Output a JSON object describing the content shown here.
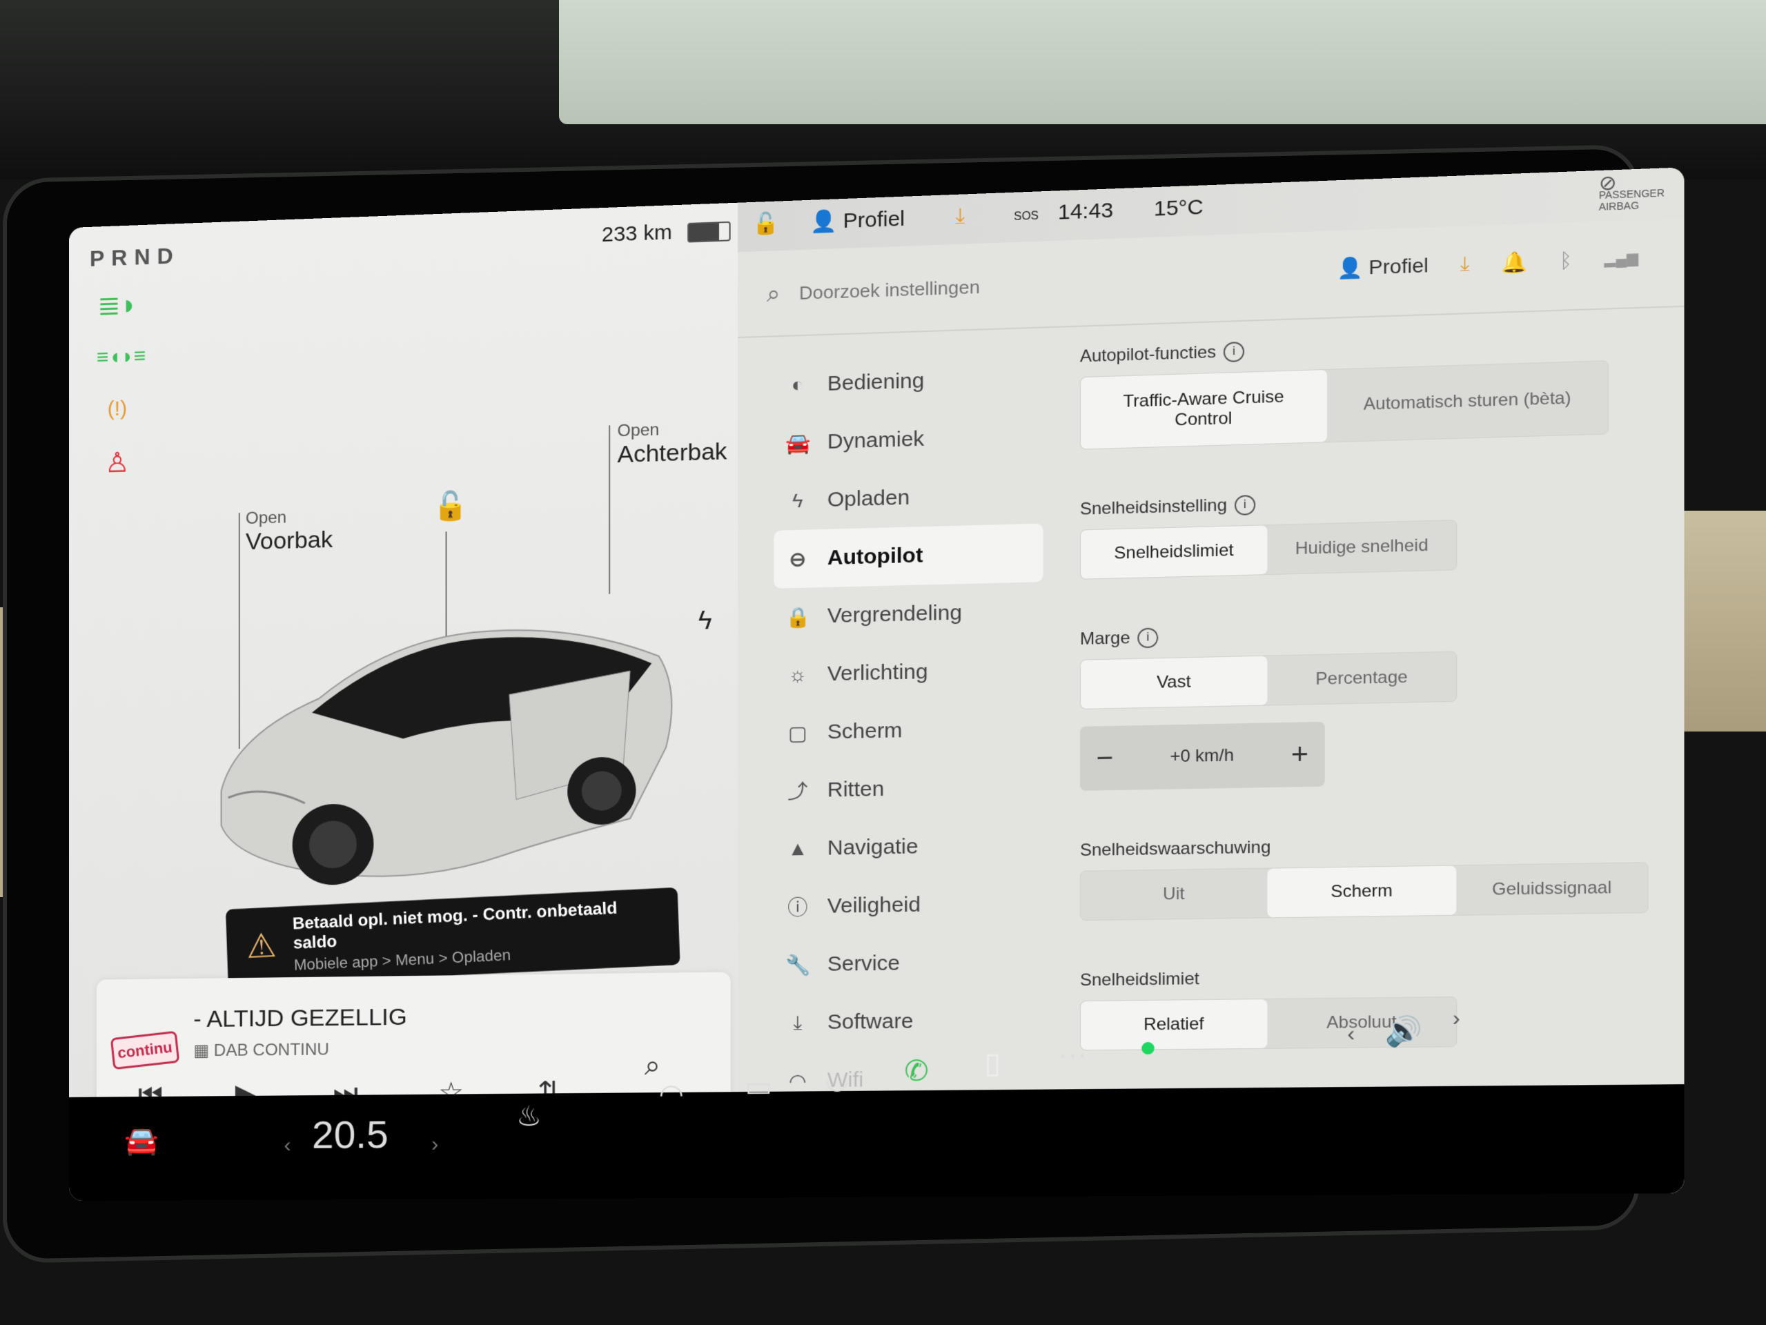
{
  "left_panel": {
    "gear": "PRND",
    "range": "233 km",
    "battery_level": 0.75,
    "telltales": [
      {
        "name": "high-beam-icon",
        "glyph": "≣D",
        "color": "#3fbf5a"
      },
      {
        "name": "parking-lights-icon",
        "glyph": "≡DC≡",
        "color": "#3fbf5a"
      },
      {
        "name": "tire-pressure-icon",
        "glyph": "(!)",
        "color": "#e39a32"
      },
      {
        "name": "seatbelt-icon",
        "glyph": "✗",
        "color": "#e0333b"
      }
    ],
    "frunk": {
      "action": "Open",
      "label": "Voorbak"
    },
    "trunk": {
      "action": "Open",
      "label": "Achterbak"
    },
    "alert": {
      "title": "Betaald opl. niet mog. - Contr. onbetaald saldo",
      "subtitle": "Mobiele app > Menu > Opladen"
    },
    "media": {
      "station_logo": "continu",
      "title": "- ALTIJD GEZELLIG",
      "source": "DAB CONTINU",
      "page_indicator": "• • •"
    }
  },
  "status_bar": {
    "profile": "Profiel",
    "time": "14:43",
    "temperature": "15°C",
    "sos": "SOS",
    "airbag_line1": "PASSENGER",
    "airbag_line2": "AIRBAG"
  },
  "settings": {
    "search_placeholder": "Doorzoek instellingen",
    "profile": "Profiel",
    "nav": [
      {
        "label": "Bediening",
        "icon": "toggle-icon",
        "glyph": "◐"
      },
      {
        "label": "Dynamiek",
        "icon": "car-icon",
        "glyph": "🚘"
      },
      {
        "label": "Opladen",
        "icon": "bolt-icon",
        "glyph": "ϟ"
      },
      {
        "label": "Autopilot",
        "icon": "steering-wheel-icon",
        "glyph": "⊖",
        "active": true
      },
      {
        "label": "Vergrendeling",
        "icon": "lock-icon",
        "glyph": "🔒"
      },
      {
        "label": "Verlichting",
        "icon": "light-icon",
        "glyph": "☼"
      },
      {
        "label": "Scherm",
        "icon": "display-icon",
        "glyph": "▢"
      },
      {
        "label": "Ritten",
        "icon": "trips-icon",
        "glyph": "⤴"
      },
      {
        "label": "Navigatie",
        "icon": "navigation-icon",
        "glyph": "▲"
      },
      {
        "label": "Veiligheid",
        "icon": "safety-icon",
        "glyph": "ⓘ"
      },
      {
        "label": "Service",
        "icon": "wrench-icon",
        "glyph": "🔧"
      },
      {
        "label": "Software",
        "icon": "download-icon",
        "glyph": "⤓"
      },
      {
        "label": "Wifi",
        "icon": "wifi-icon",
        "glyph": "◠"
      }
    ],
    "autopilot_features": {
      "label": "Autopilot-functies",
      "options": [
        "Traffic-Aware Cruise Control",
        "Automatisch sturen (bèta)"
      ],
      "selected": 0
    },
    "speed_setting": {
      "label": "Snelheidsinstelling",
      "options": [
        "Snelheidslimiet",
        "Huidige snelheid"
      ],
      "selected": 0
    },
    "margin": {
      "label": "Marge",
      "options": [
        "Vast",
        "Percentage"
      ],
      "selected": 0,
      "value": "+0 km/h",
      "minus": "−",
      "plus": "+"
    },
    "speed_warning": {
      "label": "Snelheidswaarschuwing",
      "options": [
        "Uit",
        "Scherm",
        "Geluidssignaal"
      ],
      "selected": 1
    },
    "speed_limit": {
      "label": "Snelheidslimiet",
      "options": [
        "Relatief",
        "Absoluut"
      ],
      "selected": 0
    }
  },
  "bottom_bar": {
    "temperature": "20.5",
    "prev": "‹",
    "next": "›"
  },
  "colors": {
    "green": "#3fbf5a",
    "orange": "#e39a32",
    "red": "#e0333b",
    "spotify": "#1ed760"
  }
}
